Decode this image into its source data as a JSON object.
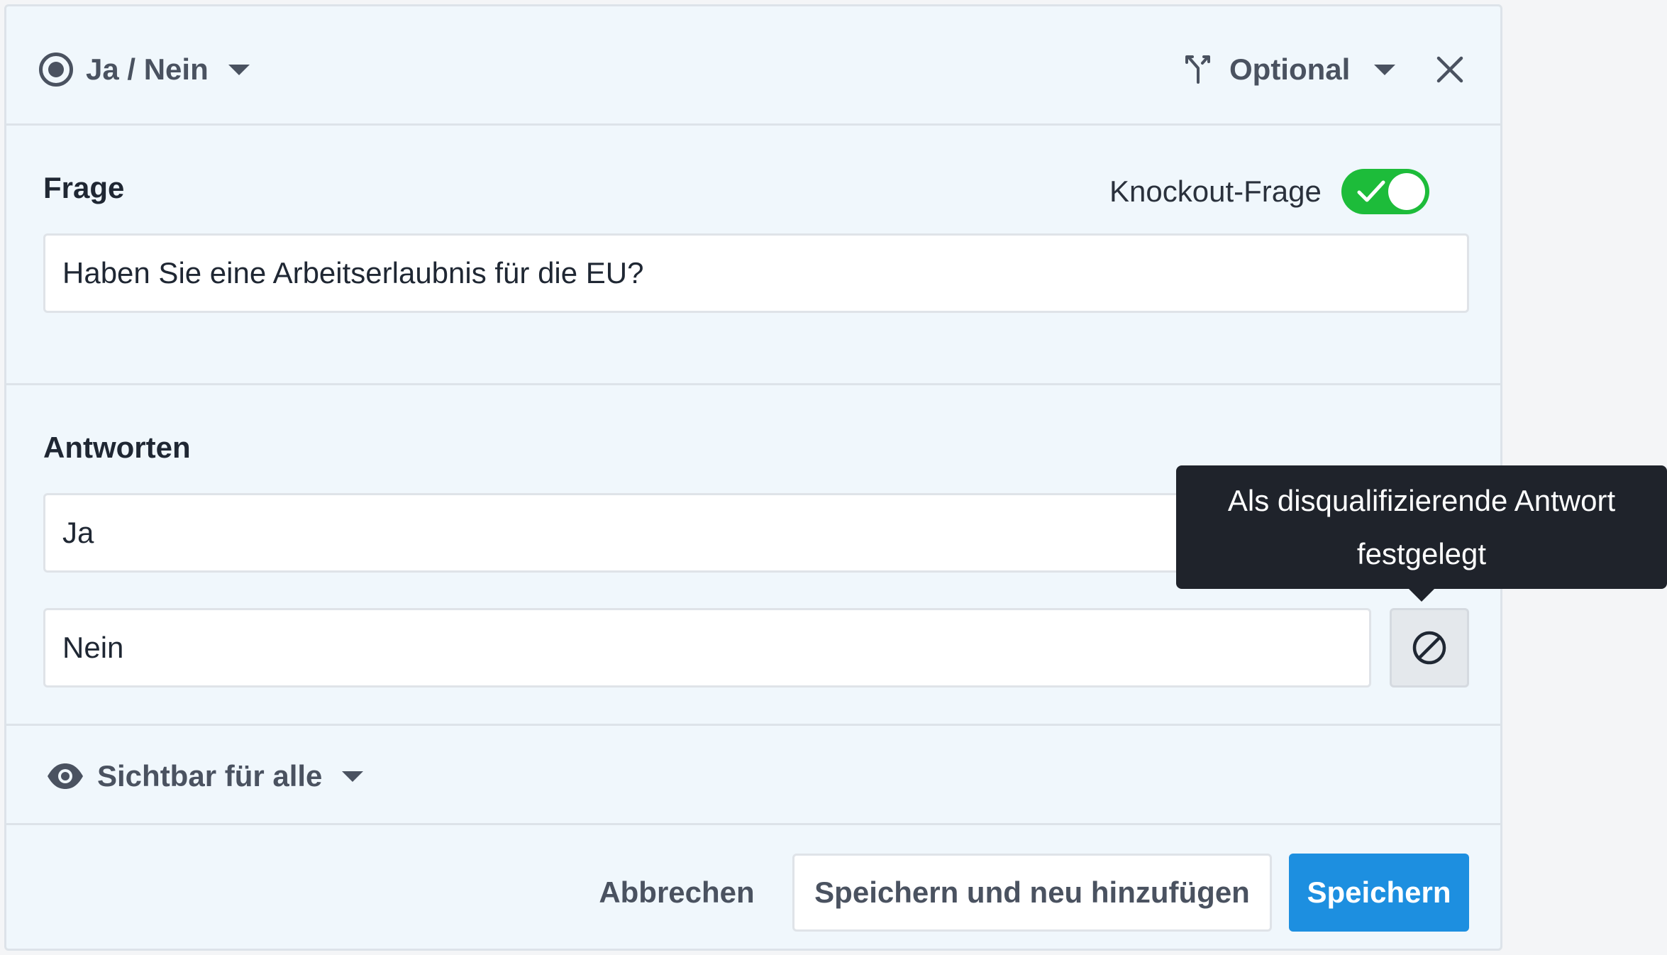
{
  "header": {
    "question_type": "Ja / Nein",
    "requirement": "Optional"
  },
  "question": {
    "title": "Frage",
    "knockout_label": "Knockout-Frage",
    "knockout_enabled": true,
    "value": "Haben Sie eine Arbeitserlaubnis für die EU?"
  },
  "answers": {
    "title": "Antworten",
    "items": [
      {
        "value": "Ja"
      },
      {
        "value": "Nein",
        "disqualifying": true
      }
    ],
    "tooltip_line1": "Als disqualifizierende Antwort",
    "tooltip_line2": "festgelegt"
  },
  "visibility": {
    "label": "Sichtbar für alle"
  },
  "footer": {
    "cancel_label": "Abbrechen",
    "save_new_label": "Speichern und neu hinzufügen",
    "save_label": "Speichern"
  },
  "colors": {
    "toggle_on": "#1dbc3a",
    "primary": "#1d8fe0",
    "card_bg": "#f0f7fc",
    "tooltip_bg": "#1f232b"
  },
  "icons": {
    "type": "radio-icon",
    "requirement": "branch-icon",
    "close": "close-icon",
    "toggle": "check-icon",
    "disqualify": "block-icon",
    "visibility": "eye-icon"
  }
}
